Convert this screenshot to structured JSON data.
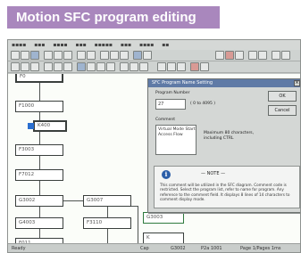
{
  "banner": {
    "title": "Motion SFC program editing"
  },
  "steps": [
    {
      "label": "F0",
      "style": "dbl"
    },
    {
      "label": "F1000",
      "style": ""
    },
    {
      "label": "K400",
      "style": "dbl"
    },
    {
      "label": "F3003",
      "style": ""
    },
    {
      "label": "F7012",
      "style": ""
    },
    {
      "label": "G3002",
      "style": ""
    },
    {
      "label": "G3007",
      "style": ""
    },
    {
      "label": "G4003",
      "style": ""
    },
    {
      "label": "F3110",
      "style": ""
    },
    {
      "label": "F011",
      "style": ""
    },
    {
      "label": "G3003",
      "style": "green"
    },
    {
      "label": "K",
      "style": ""
    }
  ],
  "dialog": {
    "title": "SFC Program Name Setting",
    "close": "×",
    "program_number_label": "Program Number",
    "program_number_value": "27",
    "program_range": "( 0 to 4095 )",
    "comment_label": "Comment",
    "comment_value": "Virtual Mode Start Access Flow",
    "max_chars_note": "Maximum 80 characters, including CTRL",
    "ok_label": "OK",
    "cancel_label": "Cancel",
    "note_title": "— NOTE —",
    "note_body": "This comment will be utilized in the SFC diagram. Comment code is restricted. Select the program list, refer to name for program. Any reference to the comment field. It displays 8 lines of 14 characters to comment display mode."
  },
  "status": {
    "mode": "Ready",
    "position": "Cap",
    "a": "G3002",
    "b": "P2a 1001",
    "c": "Page 1/Pages 1ms"
  }
}
